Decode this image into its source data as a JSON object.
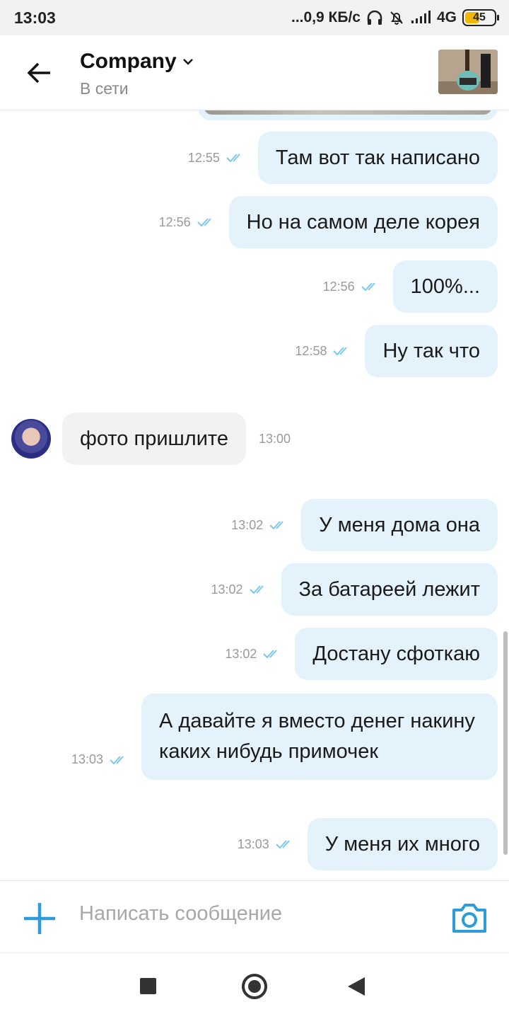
{
  "status_bar": {
    "time": "13:03",
    "network_speed": "...0,9 КБ/с",
    "network_type": "4G",
    "battery": "45",
    "battery_color": "#f2b807"
  },
  "header": {
    "title": "Company",
    "subtitle": "В сети",
    "back_icon": "arrow-left-icon",
    "dropdown_icon": "chevron-down-icon"
  },
  "messages": [
    {
      "dir": "out",
      "text": "Там вот так написано",
      "time": "12:55",
      "read": true
    },
    {
      "dir": "out",
      "text": "Но на самом деле корея",
      "time": "12:56",
      "read": true
    },
    {
      "dir": "out",
      "text": "100%...",
      "time": "12:56",
      "read": true
    },
    {
      "dir": "out",
      "text": "Ну так что",
      "time": "12:58",
      "read": true
    },
    {
      "dir": "in",
      "text": "фото пришлите",
      "time": "13:00"
    },
    {
      "dir": "out",
      "text": "У меня дома она",
      "time": "13:02",
      "read": true
    },
    {
      "dir": "out",
      "text": "За батареей лежит",
      "time": "13:02",
      "read": true
    },
    {
      "dir": "out",
      "text": "Достану сфоткаю",
      "time": "13:02",
      "read": true
    },
    {
      "dir": "out",
      "text": "А давайте я вместо денег накину каких нибудь примочек",
      "time": "13:03",
      "read": true
    },
    {
      "dir": "out",
      "text": "У меня их много",
      "time": "13:03",
      "read": true
    }
  ],
  "composer": {
    "placeholder": "Написать сообщение",
    "add_icon": "plus-icon",
    "camera_icon": "camera-icon",
    "accent": "#2d9cdb"
  },
  "colors": {
    "outgoing_bubble": "#e3f2fb",
    "incoming_bubble": "#f2f2f2",
    "read_ticks": "#7cc8ec"
  }
}
